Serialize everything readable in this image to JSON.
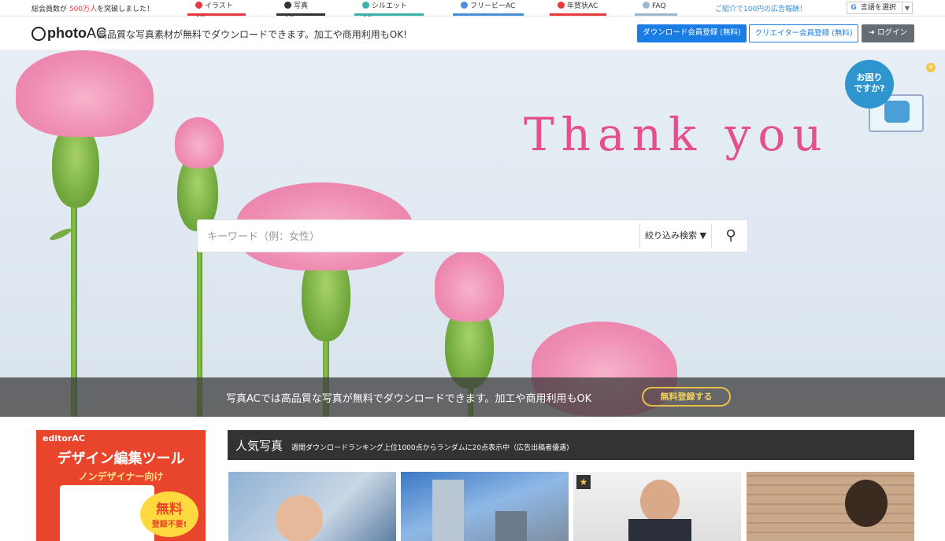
{
  "topbar": {
    "members_prefix": "総会員数が",
    "members_count": "500万人",
    "members_suffix": "を突破しました！",
    "sites": [
      {
        "label": "イラストAC",
        "icon": "illust-icon",
        "color": "#e8383d"
      },
      {
        "label": "写真AC",
        "icon": "camera-icon",
        "color": "#333333"
      },
      {
        "label": "シルエットAC",
        "icon": "silhouette-icon",
        "color": "#3bb2a7"
      },
      {
        "label": "フリービーAC",
        "icon": "freebie-icon",
        "color": "#4a90d9"
      },
      {
        "label": "年賀状AC",
        "icon": "nengajo-icon",
        "color": "#e8383d"
      },
      {
        "label": "FAQ",
        "icon": "faq-icon",
        "color": "#9ab8cf"
      }
    ],
    "ad_link": "ご紹介で100円の広告報酬！",
    "language_select": "言語を選択"
  },
  "header": {
    "logo_text": "photo",
    "logo_accent": "AC",
    "tagline": "高品質な写真素材が無料でダウンロードできます。加工や商用利用もOK!",
    "download_register": "ダウンロード会員登録 (無料)",
    "creator_register": "クリエイター会員登録 (無料)",
    "login": "ログイン"
  },
  "hero": {
    "headline": "Thank you",
    "help_bubble_line1": "お困り",
    "help_bubble_line2": "ですか?",
    "search_placeholder": "キーワード（例：女性）",
    "filter_label": "絞り込み検索",
    "band_message": "写真ACでは高品質な写真が無料でダウンロードできます。加工や商用利用もOK",
    "free_register": "無料登録する"
  },
  "ad": {
    "brand": "editorAC",
    "heading": "デザイン編集ツール",
    "subheading": "ノンデザイナー向け",
    "badge_main": "無料",
    "badge_sub": "登録不要!"
  },
  "popular": {
    "title": "人気写真",
    "description": "週間ダウンロードランキング上位1000点からランダムに20点表示中（広告出稿者優遇)"
  },
  "colors": {
    "accent_blue": "#1a7de6",
    "brand_pink": "#e3508a",
    "band_gold": "#e6c04a"
  }
}
